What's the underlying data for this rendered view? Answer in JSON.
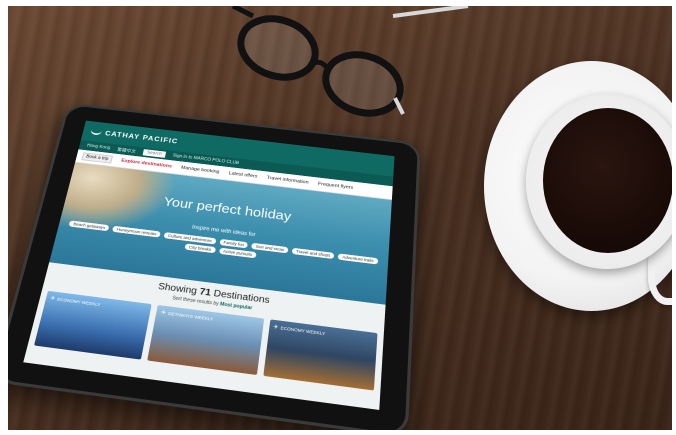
{
  "site": {
    "brand": "CATHAY PACIFIC",
    "region": "Hong Kong",
    "language": "繁體中文",
    "search_placeholder": "Search",
    "signin": "Sign in to MARCO POLO CLUB"
  },
  "nav": {
    "book_label": "Book a trip",
    "items": [
      {
        "label": "Explore destinations",
        "active": true
      },
      {
        "label": "Manage booking",
        "active": false
      },
      {
        "label": "Latest offers",
        "active": false
      },
      {
        "label": "Travel information",
        "active": false
      },
      {
        "label": "Frequent flyers",
        "active": false
      }
    ]
  },
  "hero": {
    "title": "Your perfect holiday",
    "inspire": "Inspire me with ideas for",
    "chips": [
      "Beach getaways",
      "Honeymoon retreats",
      "Culture and adventure",
      "Family fun",
      "Sun and snow",
      "Travel and shops",
      "Adventure trails",
      "City breaks",
      "Active pursuits"
    ]
  },
  "results": {
    "showing_prefix": "Showing",
    "count": "71",
    "showing_suffix": "Destinations",
    "sort_prefix": "Sort these results by",
    "sort_value": "Most popular"
  },
  "cards": [
    {
      "tag": "ECONOMY WEEKLY"
    },
    {
      "tag": "GETAWAYS WEEKLY"
    },
    {
      "tag": "ECONOMY WEEKLY"
    }
  ],
  "colors": {
    "brand_green": "#0f6a63",
    "accent_red": "#c5283d"
  }
}
